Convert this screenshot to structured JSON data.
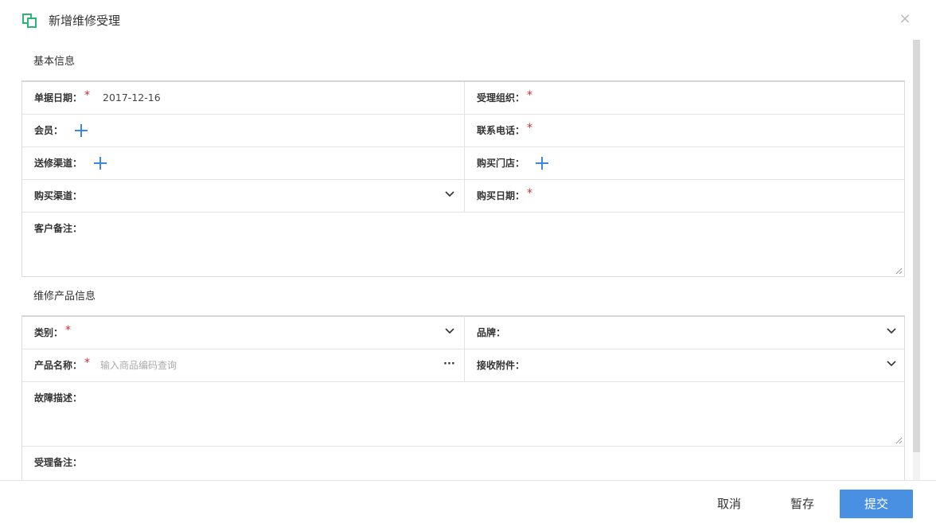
{
  "dialog": {
    "title": "新增维修受理",
    "close_symbol": "×",
    "icon": "copy-icon",
    "accent_color": "#2bb673"
  },
  "basic_info": {
    "section_title": "基本信息",
    "fields": {
      "doc_date_label": "单据日期：",
      "doc_date_value": "2017-12-16",
      "org_label": "受理组织：",
      "member_label": "会员：",
      "phone_label": "联系电话：",
      "send_channel_label": "送修渠道：",
      "store_label": "购买门店：",
      "buy_channel_label": "购买渠道：",
      "buy_date_label": "购买日期：",
      "customer_note_label": "客户备注："
    },
    "required_mark": "*"
  },
  "product_info": {
    "section_title": "维修产品信息",
    "fields": {
      "category_label": "类别：",
      "brand_label": "品牌：",
      "product_name_label": "产品名称：",
      "product_name_placeholder": "输入商品编码查询",
      "more_symbol": "···",
      "accessory_label": "接收附件：",
      "fault_label": "故障描述：",
      "accept_note_label": "受理备注："
    }
  },
  "footer": {
    "cancel_label": "取消",
    "save_label": "暂存",
    "submit_label": "提交",
    "primary_color": "#4a90e2"
  }
}
